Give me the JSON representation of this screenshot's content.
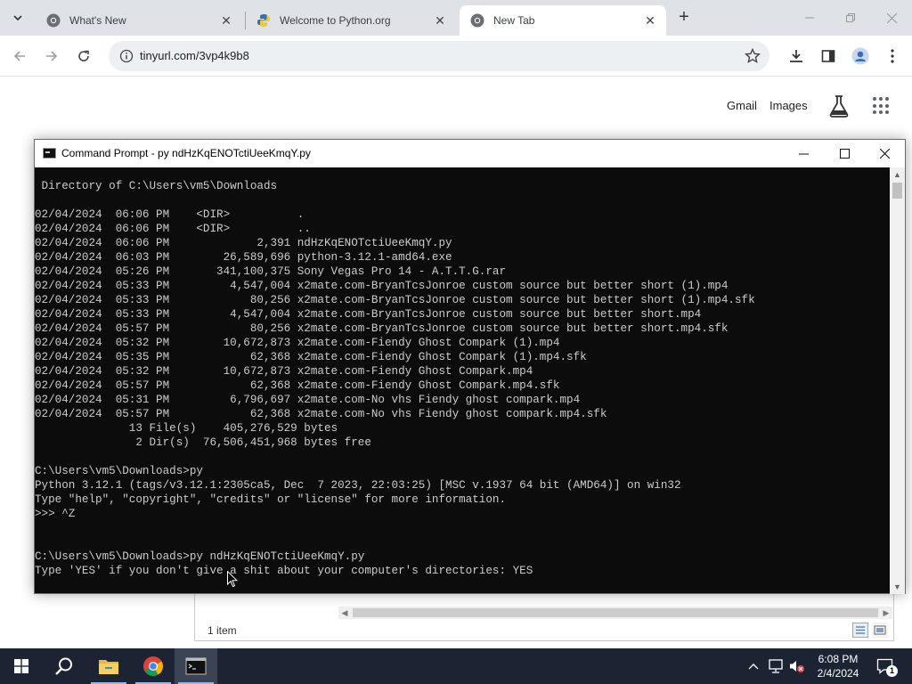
{
  "browser": {
    "tabs": [
      {
        "title": "What's New",
        "favicon": "chrome-icon",
        "close": "✕"
      },
      {
        "title": "Welcome to Python.org",
        "favicon": "python-icon",
        "close": "✕"
      },
      {
        "title": "New Tab",
        "favicon": "chrome-icon",
        "close": "✕",
        "active": true
      }
    ],
    "new_tab_label": "+",
    "url": "tinyurl.com/3vp4k9b8",
    "ntp_links": {
      "gmail": "Gmail",
      "images": "Images"
    }
  },
  "cmd": {
    "title": "Command Prompt - py  ndHzKqENOTctiUeeKmqY.py",
    "lines": [
      " Directory of C:\\Users\\vm5\\Downloads",
      "",
      "02/04/2024  06:06 PM    <DIR>          .",
      "02/04/2024  06:06 PM    <DIR>          ..",
      "02/04/2024  06:06 PM             2,391 ndHzKqENOTctiUeeKmqY.py",
      "02/04/2024  06:03 PM        26,589,696 python-3.12.1-amd64.exe",
      "02/04/2024  05:26 PM       341,100,375 Sony Vegas Pro 14 - A.T.T.G.rar",
      "02/04/2024  05:33 PM         4,547,004 x2mate.com-BryanTcsJonroe custom source but better short (1).mp4",
      "02/04/2024  05:33 PM            80,256 x2mate.com-BryanTcsJonroe custom source but better short (1).mp4.sfk",
      "02/04/2024  05:33 PM         4,547,004 x2mate.com-BryanTcsJonroe custom source but better short.mp4",
      "02/04/2024  05:57 PM            80,256 x2mate.com-BryanTcsJonroe custom source but better short.mp4.sfk",
      "02/04/2024  05:32 PM        10,672,873 x2mate.com-Fiendy Ghost Compark (1).mp4",
      "02/04/2024  05:35 PM            62,368 x2mate.com-Fiendy Ghost Compark (1).mp4.sfk",
      "02/04/2024  05:32 PM        10,672,873 x2mate.com-Fiendy Ghost Compark.mp4",
      "02/04/2024  05:57 PM            62,368 x2mate.com-Fiendy Ghost Compark.mp4.sfk",
      "02/04/2024  05:31 PM         6,796,697 x2mate.com-No vhs Fiendy ghost compark.mp4",
      "02/04/2024  05:57 PM            62,368 x2mate.com-No vhs Fiendy ghost compark.mp4.sfk",
      "              13 File(s)    405,276,529 bytes",
      "               2 Dir(s)  76,506,451,968 bytes free",
      "",
      "C:\\Users\\vm5\\Downloads>py",
      "Python 3.12.1 (tags/v3.12.1:2305ca5, Dec  7 2023, 22:03:25) [MSC v.1937 64 bit (AMD64)] on win32",
      "Type \"help\", \"copyright\", \"credits\" or \"license\" for more information.",
      ">>> ^Z",
      "",
      "",
      "C:\\Users\\vm5\\Downloads>py ndHzKqENOTctiUeeKmqY.py",
      "Type 'YES' if you don't give a shit about your computer's directories: YES"
    ]
  },
  "explorer": {
    "item_count": "1 item"
  },
  "taskbar": {
    "time": "6:08 PM",
    "date": "2/4/2024",
    "notification_count": "1"
  },
  "colors": {
    "console_bg": "#0c0c0c",
    "console_text": "#cccccc",
    "taskbar_bg": "#1c2433",
    "tabstrip_bg": "#dfe3e7"
  }
}
